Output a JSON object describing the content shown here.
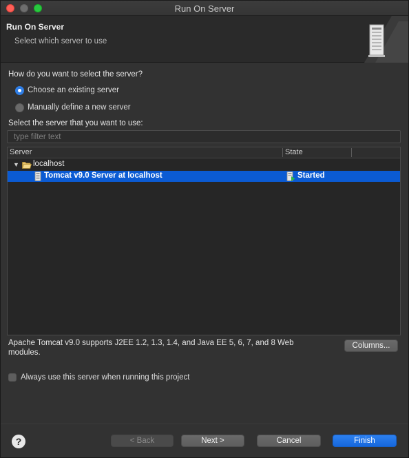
{
  "window": {
    "title": "Run On Server"
  },
  "header": {
    "title": "Run On Server",
    "subtitle": "Select which server to use",
    "graphic_icon": "server-tower-icon"
  },
  "selection": {
    "question": "How do you want to select the server?",
    "options": [
      {
        "label": "Choose an existing server",
        "selected": true
      },
      {
        "label": "Manually define a new server",
        "selected": false
      }
    ]
  },
  "server_list": {
    "label": "Select the server that you want to use:",
    "filter_placeholder": "type filter text",
    "filter_value": "",
    "columns": [
      "Server",
      "State"
    ],
    "tree": [
      {
        "label": "localhost",
        "icon": "folder-open-icon",
        "expanded": true
      },
      {
        "label": "Tomcat v9.0 Server at localhost",
        "icon": "server-icon",
        "state": "Started",
        "state_icon": "server-started-icon",
        "selected": true
      }
    ]
  },
  "description": "Apache Tomcat v9.0 supports J2EE 1.2, 1.3, 1.4, and Java EE 5, 6, 7, and 8 Web modules.",
  "columns_button": "Columns...",
  "always_use": {
    "label": "Always use this server when running this project",
    "checked": false
  },
  "footer": {
    "help_icon": "help-icon",
    "back": "< Back",
    "next": "Next >",
    "cancel": "Cancel",
    "finish": "Finish"
  },
  "colors": {
    "selection": "#0b5bd3",
    "accent": "#2f7ee6",
    "background": "#323232"
  }
}
